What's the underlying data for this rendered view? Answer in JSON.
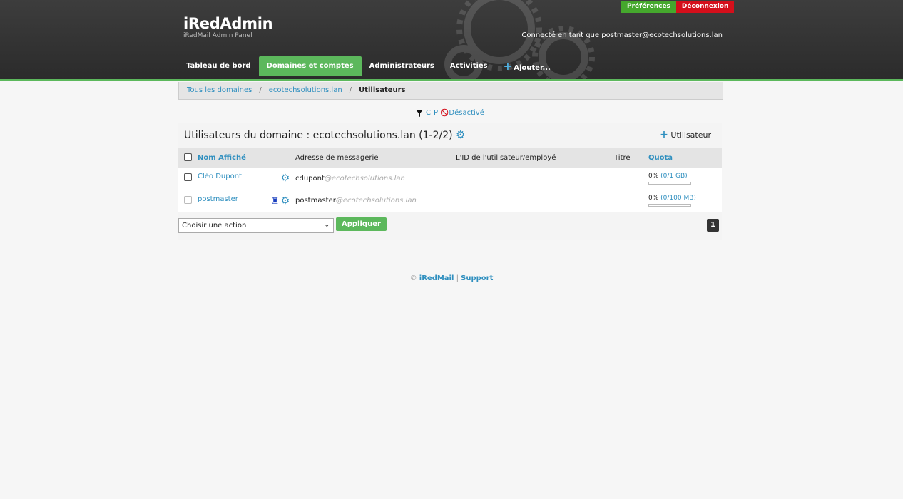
{
  "header": {
    "title": "iRedAdmin",
    "subtitle": "iRedMail Admin Panel",
    "preferences_label": "Préférences",
    "logout_label": "Déconnexion",
    "login_info": "Connecté en tant que postmaster@ecotechsolutions.lan",
    "accent_color": "#5cb85c",
    "logout_color": "#d40f1b"
  },
  "nav": {
    "items": [
      {
        "label": "Tableau de bord"
      },
      {
        "label": "Domaines et comptes",
        "active": true
      },
      {
        "label": "Administrateurs"
      },
      {
        "label": "Activities"
      },
      {
        "label": "Ajouter..."
      }
    ]
  },
  "breadcrumb": {
    "items": [
      "Tous les domaines",
      "ecotechsolutions.lan",
      "Utilisateurs"
    ],
    "separator": "/"
  },
  "filters": {
    "c": "C",
    "p": "P",
    "bar": "|",
    "disabled": "Désactivé"
  },
  "panel": {
    "title": "Utilisateurs du domaine : ecotechsolutions.lan (1-2/2)",
    "add_user_label": "Utilisateur",
    "columns": [
      "Nom Affiché",
      "Adresse de messagerie",
      "L'ID de l'utilisateur/employé",
      "Titre",
      "Quota"
    ],
    "rows": [
      {
        "name": "Cléo Dupont",
        "local": "cdupont",
        "domain": "@ecotechsolutions.lan",
        "employee_id": "",
        "title": "",
        "quota_pct": "0%",
        "quota_link": "(0/1 GB)",
        "quota_fraction": 0,
        "is_admin": false
      },
      {
        "name": "postmaster",
        "local": "postmaster",
        "domain": "@ecotechsolutions.lan",
        "employee_id": "",
        "title": "",
        "quota_pct": "0%",
        "quota_link": "(0/100 MB)",
        "quota_fraction": 0,
        "is_admin": true
      }
    ],
    "action_select": "Choisir une action",
    "apply_label": "Appliquer",
    "page_number": "1"
  },
  "footer": {
    "copyright": "©",
    "iredmail": "iRedMail",
    "sep": "|",
    "support": "Support"
  }
}
